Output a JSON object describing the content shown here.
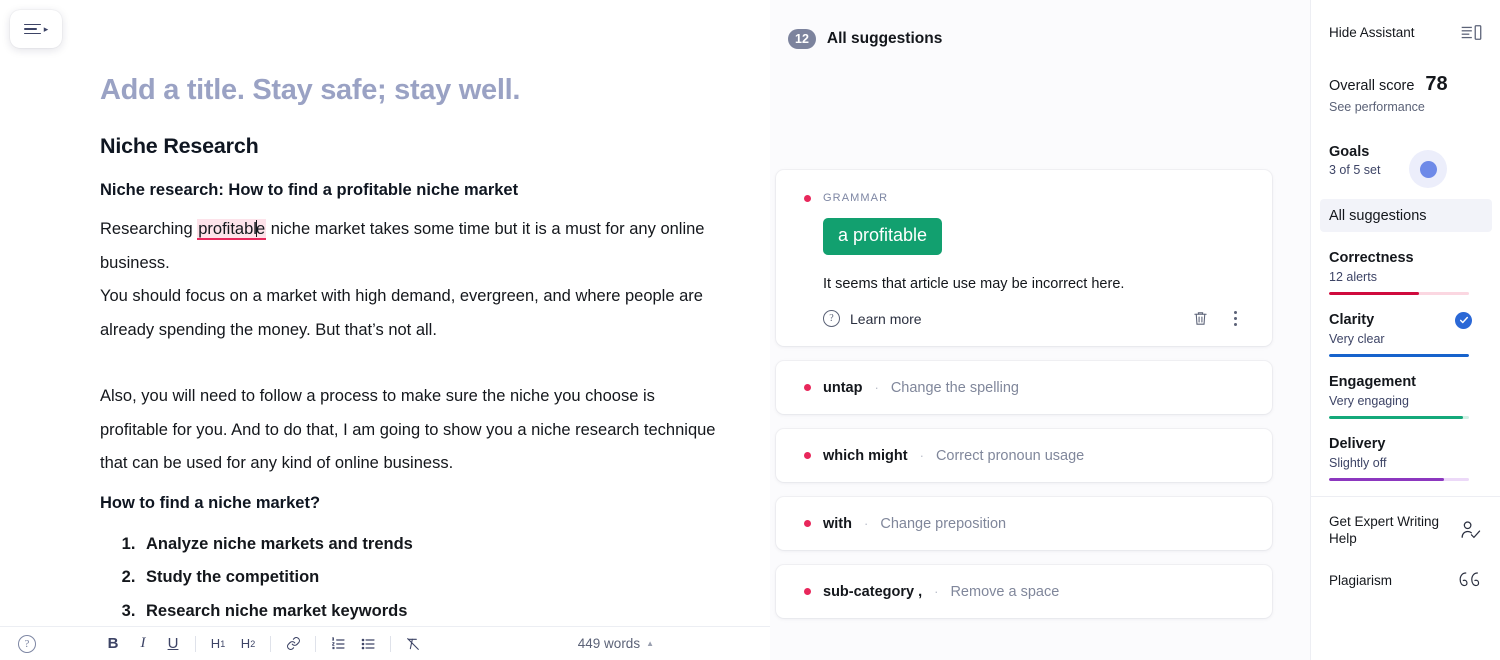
{
  "editor": {
    "menu_button_name": "hamburger-menu",
    "title_placeholder": "Add a title. Stay safe; stay well.",
    "heading": "Niche Research",
    "subheading": "Niche research: How to find a profitable niche market",
    "paragraph_1_before": "Researching ",
    "paragraph_1_highlight": "profitabl",
    "paragraph_1_highlight_rest": "e",
    "paragraph_1_after": " niche market takes some time but it is a must for any online business.",
    "paragraph_2": "You should focus on a market with high demand, evergreen, and where people are already spending the money. But that’s not all.",
    "paragraph_3": "Also, you will need to follow a process to make sure the niche you choose is profitable for you. And to do that, I am going to show you a niche research technique that can be used for any kind of online business.",
    "heading_2": "How to find a niche market?",
    "list_items": [
      "Analyze niche markets and trends",
      "Study the competition",
      "Research niche market keywords"
    ],
    "highlight_color": "#fde3ea",
    "underline_color": "#e8275b"
  },
  "toolbar": {
    "help_icon": "help-circle-icon",
    "bold_label": "B",
    "italic_label": "I",
    "underline_label": "U",
    "h1_label": "H",
    "h1_sub": "1",
    "h2_label": "H",
    "h2_sub": "2",
    "link_icon": "link-icon",
    "ordered_list_icon": "numbered-list-icon",
    "bullet_list_icon": "bullet-list-icon",
    "clear_format_icon": "clear-formatting-icon",
    "word_count": "449 words",
    "word_count_chevron": "▲"
  },
  "suggestions": {
    "badge_count": "12",
    "header_label": "All suggestions",
    "main_card": {
      "category": "GRAMMAR",
      "category_dot_color": "#e8275b",
      "replacement": "a profitable",
      "replacement_color": "#12a06f",
      "description": "It seems that article use may be incorrect here.",
      "learn_more": "Learn more",
      "delete_icon": "trash-icon",
      "more_icon": "kebab-menu-icon"
    },
    "items": [
      {
        "term": "untap",
        "separator": "·",
        "action": "Change the spelling"
      },
      {
        "term": "which might",
        "separator": "·",
        "action": "Correct pronoun usage"
      },
      {
        "term": "with",
        "separator": "·",
        "action": "Change preposition"
      },
      {
        "term": "sub-category ,",
        "separator": "·",
        "action": "Remove a space"
      }
    ]
  },
  "assistant": {
    "hide_label": "Hide Assistant",
    "hide_icon": "panel-toggle-icon",
    "overall_score_label": "Overall score",
    "overall_score_value": "78",
    "see_performance": "See performance",
    "goals_title": "Goals",
    "goals_sub": "3 of 5 set",
    "goals_color": "#6e8ae8",
    "all_suggestions_tab": "All suggestions",
    "metrics": [
      {
        "name": "Correctness",
        "sub": "12 alerts",
        "fill": 64,
        "color": "#cf0a3d",
        "track": "#fbd7e1",
        "check": false
      },
      {
        "name": "Clarity",
        "sub": "Very clear",
        "fill": 100,
        "color": "#1763cc",
        "track": "#d7e4f8",
        "check": true
      },
      {
        "name": "Engagement",
        "sub": "Very engaging",
        "fill": 96,
        "color": "#14a97a",
        "track": "#d2f0e5",
        "check": false
      },
      {
        "name": "Delivery",
        "sub": "Slightly off",
        "fill": 82,
        "color": "#8c37bf",
        "track": "#ecd9f8",
        "check": false
      }
    ],
    "expert_help_label": "Get Expert Writing Help",
    "expert_help_icon": "person-check-icon",
    "plagiarism_label": "Plagiarism",
    "plagiarism_icon": "quotation-marks-icon"
  }
}
